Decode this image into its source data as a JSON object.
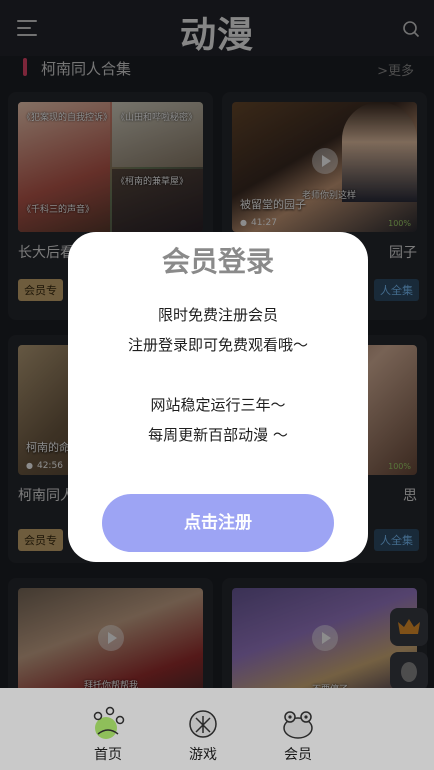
{
  "header": {
    "logo": "动漫",
    "menu_icon": "menu-icon",
    "search_icon": "search-icon"
  },
  "section": {
    "title": "柯南同人合集",
    "more": ">更多"
  },
  "cards": [
    {
      "thumb_texts": [
        "《犯案现的自我控诉》",
        "《山田和哔啦秘密》",
        "《柯南的兼草屋》",
        "《千科三的声音》"
      ],
      "title": "长大后看柯",
      "badge": "会员专"
    },
    {
      "caption_top": "老师你别这样",
      "caption": "被留堂的园子",
      "duration": "41:27",
      "likes": "100%",
      "title": "园子"
    },
    {
      "caption": "柯南的命",
      "duration": "42:56",
      "title": "柯南同人",
      "badge": "会员专"
    },
    {
      "likes": "100%",
      "title": "思",
      "badge": "人全集"
    },
    {
      "caption": "拜托你帮帮我"
    },
    {
      "caption": "不要停了"
    }
  ],
  "card2_badge": "人全集",
  "modal": {
    "title": "会员登录",
    "lines": [
      "限时免费注册会员",
      "注册登录即可免费观看哦～",
      "网站稳定运行三年～",
      "每周更新百部动漫 ～"
    ],
    "button": "点击注册"
  },
  "tabs": [
    {
      "label": "首页",
      "icon": "frog-hand-icon"
    },
    {
      "label": "游戏",
      "icon": "game-icon"
    },
    {
      "label": "会员",
      "icon": "frog-face-icon"
    }
  ],
  "colors": {
    "accent": "#e2456a",
    "button": "#9da4f4",
    "tabbar": "#c9c9c9"
  }
}
